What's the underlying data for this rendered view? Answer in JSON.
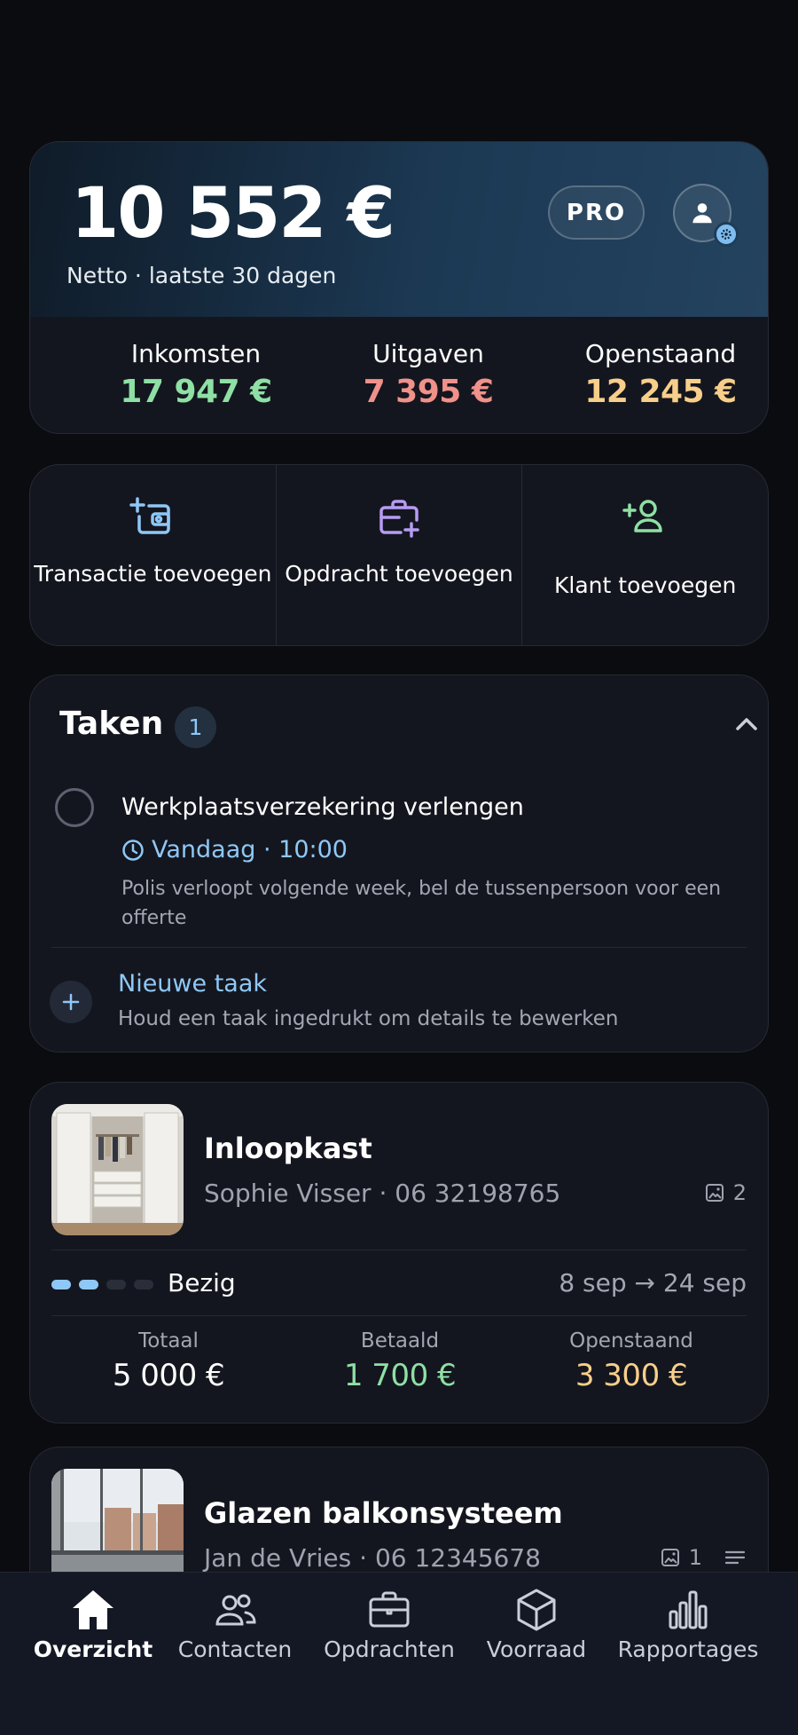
{
  "summary": {
    "net_amount": "10 552 €",
    "net_subtitle": "Netto · laatste 30 dagen",
    "pro_label": "PRO",
    "stats": [
      {
        "label": "Inkomsten",
        "value": "17 947 €",
        "color": "#8ee0a4"
      },
      {
        "label": "Uitgaven",
        "value": "7 395 €",
        "color": "#f0918a"
      },
      {
        "label": "Openstaand",
        "value": "12 245 €",
        "color": "#f7cf8a"
      }
    ]
  },
  "actions": [
    {
      "label": "Transactie toevoegen",
      "icon": "add-receipt-icon",
      "color": "#8ec8f7"
    },
    {
      "label": "Opdracht toevoegen",
      "icon": "briefcase-plus-icon",
      "color": "#b79cf2"
    },
    {
      "label": "Klant toevoegen",
      "icon": "add-person-icon",
      "color": "#8ee0a4"
    }
  ],
  "tasks": {
    "title": "Taken",
    "count": "1",
    "items": [
      {
        "title": "Werkplaatsverzekering verlengen",
        "due": "Vandaag · 10:00",
        "note": "Polis verloopt volgende week, bel de tussenpersoon voor een offerte"
      }
    ],
    "new_task_label": "Nieuwe taak",
    "new_task_hint": "Houd een taak ingedrukt om details te bewerken"
  },
  "jobs": [
    {
      "title": "Inloopkast",
      "client": "Sophie Visser",
      "phone": "· 06 32198765",
      "photo_count": "2",
      "progress_steps_done": 2,
      "progress_steps_total": 4,
      "status": "Bezig",
      "dates": "8 sep → 24 sep",
      "totals": [
        {
          "label": "Totaal",
          "value": "5 000 €",
          "color": "#ffffff"
        },
        {
          "label": "Betaald",
          "value": "1 700 €",
          "color": "#8ee0a4"
        },
        {
          "label": "Openstaand",
          "value": "3 300 €",
          "color": "#f7cf8a"
        }
      ]
    },
    {
      "title": "Glazen balkonsysteem",
      "client": "Jan de Vries",
      "phone": "· 06 12345678",
      "photo_count": "1"
    }
  ],
  "nav": [
    {
      "label": "Overzicht",
      "icon": "home-icon",
      "active": true
    },
    {
      "label": "Contacten",
      "icon": "contacts-icon",
      "active": false
    },
    {
      "label": "Opdrachten",
      "icon": "briefcase-icon",
      "active": false
    },
    {
      "label": "Voorraad",
      "icon": "box-icon",
      "active": false
    },
    {
      "label": "Rapportages",
      "icon": "bar-chart-icon",
      "active": false
    }
  ]
}
